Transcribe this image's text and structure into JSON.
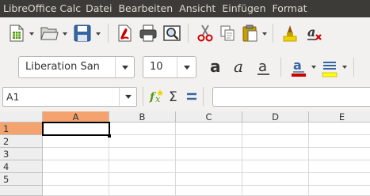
{
  "menubar": {
    "app_title": "LibreOffice Calc",
    "items": [
      "Datei",
      "Bearbeiten",
      "Ansicht",
      "Einfügen",
      "Format"
    ]
  },
  "toolbar_standard": {
    "icons": [
      "new-document-icon",
      "open-folder-icon",
      "save-icon",
      "export-pdf-icon",
      "print-icon",
      "print-preview-icon",
      "cut-icon",
      "copy-icon",
      "paste-icon",
      "clone-formatting-icon",
      "clear-formatting-icon"
    ]
  },
  "toolbar_formatting": {
    "font_name": "Liberation San",
    "font_size": "10",
    "colors": {
      "font_color": "#cc0000",
      "highlight_color": "#ffff00"
    }
  },
  "formula_bar": {
    "name_box": "A1",
    "formula_value": ""
  },
  "sheet": {
    "columns": [
      "A",
      "B",
      "C",
      "D",
      "E"
    ],
    "rows": [
      "1",
      "2",
      "3",
      "4",
      "5"
    ],
    "selected_cell": "A1",
    "header_highlight": "#f4a36f"
  }
}
